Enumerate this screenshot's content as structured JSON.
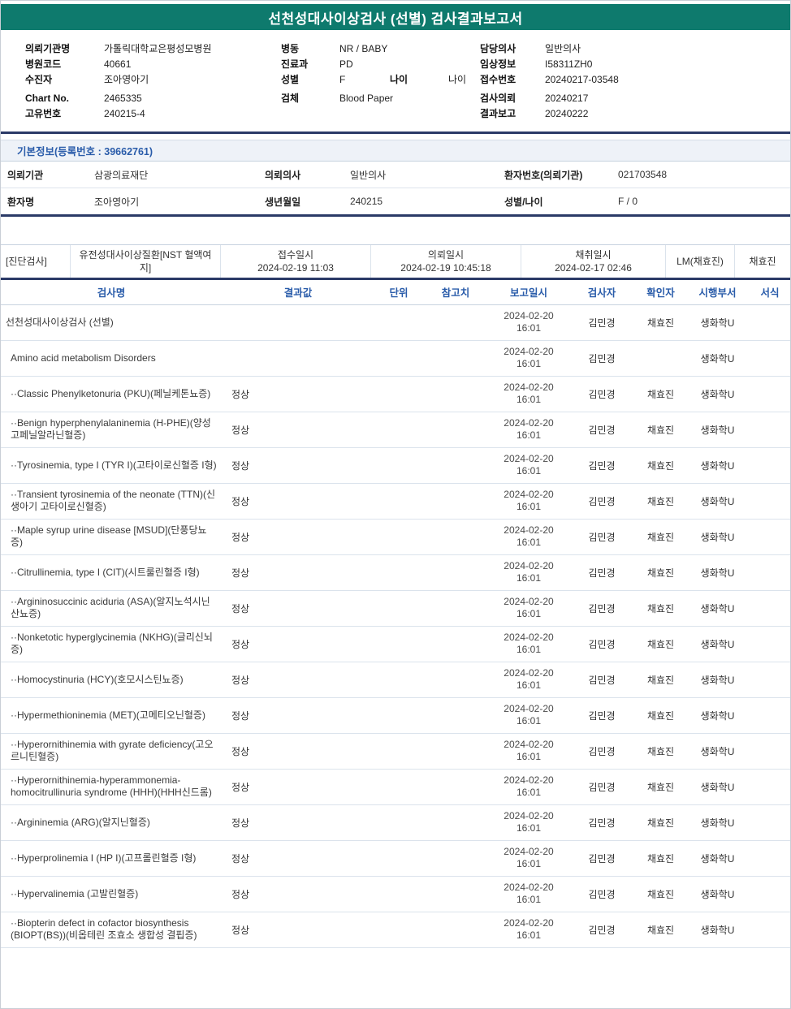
{
  "header": {
    "title": "선천성대사이상검사 (선별) 검사결과보고서"
  },
  "colors": {
    "header_teal": "#0e7a6d",
    "accent_blue": "#2a5caa",
    "navy_line": "#2b3a67"
  },
  "info": {
    "columns": [
      {
        "rows": [
          [
            {
              "label": "의뢰기관명",
              "value": "가톨릭대학교은평성모병원"
            }
          ],
          [
            {
              "label": "병원코드",
              "value": "40661"
            }
          ],
          [
            {
              "label": "수진자",
              "value": "조아영아기"
            }
          ],
          [
            {
              "label": "Chart No.",
              "value": "2465335"
            }
          ],
          [
            {
              "label": "고유번호",
              "value": "240215-4"
            }
          ]
        ]
      },
      {
        "rows": [
          [
            {
              "label": "병동",
              "value": "NR / BABY"
            }
          ],
          [
            {
              "label": "진료과",
              "value": "PD"
            }
          ],
          [
            {
              "label": "성별",
              "value": "F"
            },
            {
              "label": "나이",
              "value": "나이"
            }
          ],
          [
            {
              "label": "검체",
              "value": "Blood Paper"
            }
          ]
        ]
      },
      {
        "rows": [
          [
            {
              "label": "담당의사",
              "value": "일반의사"
            }
          ],
          [
            {
              "label": "임상정보",
              "value": "I58311ZH0"
            }
          ],
          [
            {
              "label": "접수번호",
              "value": "20240217-03548"
            }
          ],
          [
            {
              "label": "검사의뢰",
              "value": "20240217"
            }
          ],
          [
            {
              "label": "결과보고",
              "value": "20240222"
            }
          ]
        ]
      }
    ]
  },
  "basic_info": {
    "title": "기본정보(등록번호 : 39662761)",
    "rows": [
      [
        {
          "label": "의뢰기관",
          "value": "삼광의료재단"
        },
        {
          "label": "의뢰의사",
          "value": "일반의사"
        },
        {
          "label": "환자번호(의뢰기관)",
          "value": "021703548"
        }
      ],
      [
        {
          "label": "환자명",
          "value": "조아영아기"
        },
        {
          "label": "생년월일",
          "value": "240215"
        },
        {
          "label": "성별/나이",
          "value": "F / 0"
        }
      ]
    ]
  },
  "specimen": {
    "section_label": "[진단검사]",
    "test_name": "유전성대사이상질환[NST 혈액여지]",
    "receipt_label": "접수일시",
    "receipt_value": "2024-02-19 11:03",
    "request_label": "의뢰일시",
    "request_value": "2024-02-19 10:45:18",
    "collect_label": "채취일시",
    "collect_value": "2024-02-17 02:46",
    "collector": "LM(채효진)",
    "collector_confirm": "채효진"
  },
  "results": {
    "headers": [
      "검사명",
      "결과값",
      "단위",
      "참고치",
      "보고일시",
      "검사자",
      "확인자",
      "시행부서",
      "서식"
    ],
    "rows": [
      {
        "name": "선천성대사이상검사 (선별)",
        "indent": 0,
        "result": "",
        "unit": "",
        "ref": "",
        "date": "2024-02-20",
        "time": "16:01",
        "tester": "김민경",
        "confirmer": "채효진",
        "dept": "생화학U",
        "form": ""
      },
      {
        "name": "Amino acid metabolism Disorders",
        "indent": 1,
        "result": "",
        "unit": "",
        "ref": "",
        "date": "2024-02-20",
        "time": "16:01",
        "tester": "김민경",
        "confirmer": "",
        "dept": "생화학U",
        "form": ""
      },
      {
        "name": "··Classic Phenylketonuria (PKU)(페닐케톤뇨증)",
        "indent": 1,
        "result": "정상",
        "unit": "",
        "ref": "",
        "date": "2024-02-20",
        "time": "16:01",
        "tester": "김민경",
        "confirmer": "채효진",
        "dept": "생화학U",
        "form": ""
      },
      {
        "name": "··Benign hyperphenylalaninemia (H-PHE)(양성 고페닐알라닌혈증)",
        "indent": 1,
        "result": "정상",
        "unit": "",
        "ref": "",
        "date": "2024-02-20",
        "time": "16:01",
        "tester": "김민경",
        "confirmer": "채효진",
        "dept": "생화학U",
        "form": ""
      },
      {
        "name": "··Tyrosinemia, type I (TYR I)(고타이로신혈증 I형)",
        "indent": 1,
        "result": "정상",
        "unit": "",
        "ref": "",
        "date": "2024-02-20",
        "time": "16:01",
        "tester": "김민경",
        "confirmer": "채효진",
        "dept": "생화학U",
        "form": ""
      },
      {
        "name": "··Transient tyrosinemia of the neonate (TTN)(신생아기 고타이로신혈증)",
        "indent": 1,
        "result": "정상",
        "unit": "",
        "ref": "",
        "date": "2024-02-20",
        "time": "16:01",
        "tester": "김민경",
        "confirmer": "채효진",
        "dept": "생화학U",
        "form": ""
      },
      {
        "name": "··Maple syrup urine disease [MSUD](단풍당뇨증)",
        "indent": 1,
        "result": "정상",
        "unit": "",
        "ref": "",
        "date": "2024-02-20",
        "time": "16:01",
        "tester": "김민경",
        "confirmer": "채효진",
        "dept": "생화학U",
        "form": ""
      },
      {
        "name": "··Citrullinemia, type I (CIT)(시트룰린혈증 I형)",
        "indent": 1,
        "result": "정상",
        "unit": "",
        "ref": "",
        "date": "2024-02-20",
        "time": "16:01",
        "tester": "김민경",
        "confirmer": "채효진",
        "dept": "생화학U",
        "form": ""
      },
      {
        "name": "··Argininosuccinic aciduria (ASA)(알지노석시닌산뇨증)",
        "indent": 1,
        "result": "정상",
        "unit": "",
        "ref": "",
        "date": "2024-02-20",
        "time": "16:01",
        "tester": "김민경",
        "confirmer": "채효진",
        "dept": "생화학U",
        "form": ""
      },
      {
        "name": "··Nonketotic hyperglycinemia (NKHG)(글리신뇌증)",
        "indent": 1,
        "result": "정상",
        "unit": "",
        "ref": "",
        "date": "2024-02-20",
        "time": "16:01",
        "tester": "김민경",
        "confirmer": "채효진",
        "dept": "생화학U",
        "form": ""
      },
      {
        "name": "··Homocystinuria (HCY)(호모시스틴뇨증)",
        "indent": 1,
        "result": "정상",
        "unit": "",
        "ref": "",
        "date": "2024-02-20",
        "time": "16:01",
        "tester": "김민경",
        "confirmer": "채효진",
        "dept": "생화학U",
        "form": ""
      },
      {
        "name": "··Hypermethioninemia (MET)(고메티오닌혈증)",
        "indent": 1,
        "result": "정상",
        "unit": "",
        "ref": "",
        "date": "2024-02-20",
        "time": "16:01",
        "tester": "김민경",
        "confirmer": "채효진",
        "dept": "생화학U",
        "form": ""
      },
      {
        "name": "··Hyperornithinemia with gyrate deficiency(고오르니틴혈증)",
        "indent": 1,
        "result": "정상",
        "unit": "",
        "ref": "",
        "date": "2024-02-20",
        "time": "16:01",
        "tester": "김민경",
        "confirmer": "채효진",
        "dept": "생화학U",
        "form": ""
      },
      {
        "name": "··Hyperornithinemia-hyperammonemia-homocitrullinuria syndrome (HHH)(HHH신드롬)",
        "indent": 1,
        "result": "정상",
        "unit": "",
        "ref": "",
        "date": "2024-02-20",
        "time": "16:01",
        "tester": "김민경",
        "confirmer": "채효진",
        "dept": "생화학U",
        "form": ""
      },
      {
        "name": "··Argininemia (ARG)(알지닌혈증)",
        "indent": 1,
        "result": "정상",
        "unit": "",
        "ref": "",
        "date": "2024-02-20",
        "time": "16:01",
        "tester": "김민경",
        "confirmer": "채효진",
        "dept": "생화학U",
        "form": ""
      },
      {
        "name": "··Hyperprolinemia I (HP I)(고프롤린혈증 I형)",
        "indent": 1,
        "result": "정상",
        "unit": "",
        "ref": "",
        "date": "2024-02-20",
        "time": "16:01",
        "tester": "김민경",
        "confirmer": "채효진",
        "dept": "생화학U",
        "form": ""
      },
      {
        "name": "··Hypervalinemia (고발린혈증)",
        "indent": 1,
        "result": "정상",
        "unit": "",
        "ref": "",
        "date": "2024-02-20",
        "time": "16:01",
        "tester": "김민경",
        "confirmer": "채효진",
        "dept": "생화학U",
        "form": ""
      },
      {
        "name": "··Biopterin defect in cofactor biosynthesis (BIOPT(BS))(비옵테린 조효소 생합성 결핍증)",
        "indent": 1,
        "result": "정상",
        "unit": "",
        "ref": "",
        "date": "2024-02-20",
        "time": "16:01",
        "tester": "김민경",
        "confirmer": "채효진",
        "dept": "생화학U",
        "form": ""
      }
    ]
  }
}
